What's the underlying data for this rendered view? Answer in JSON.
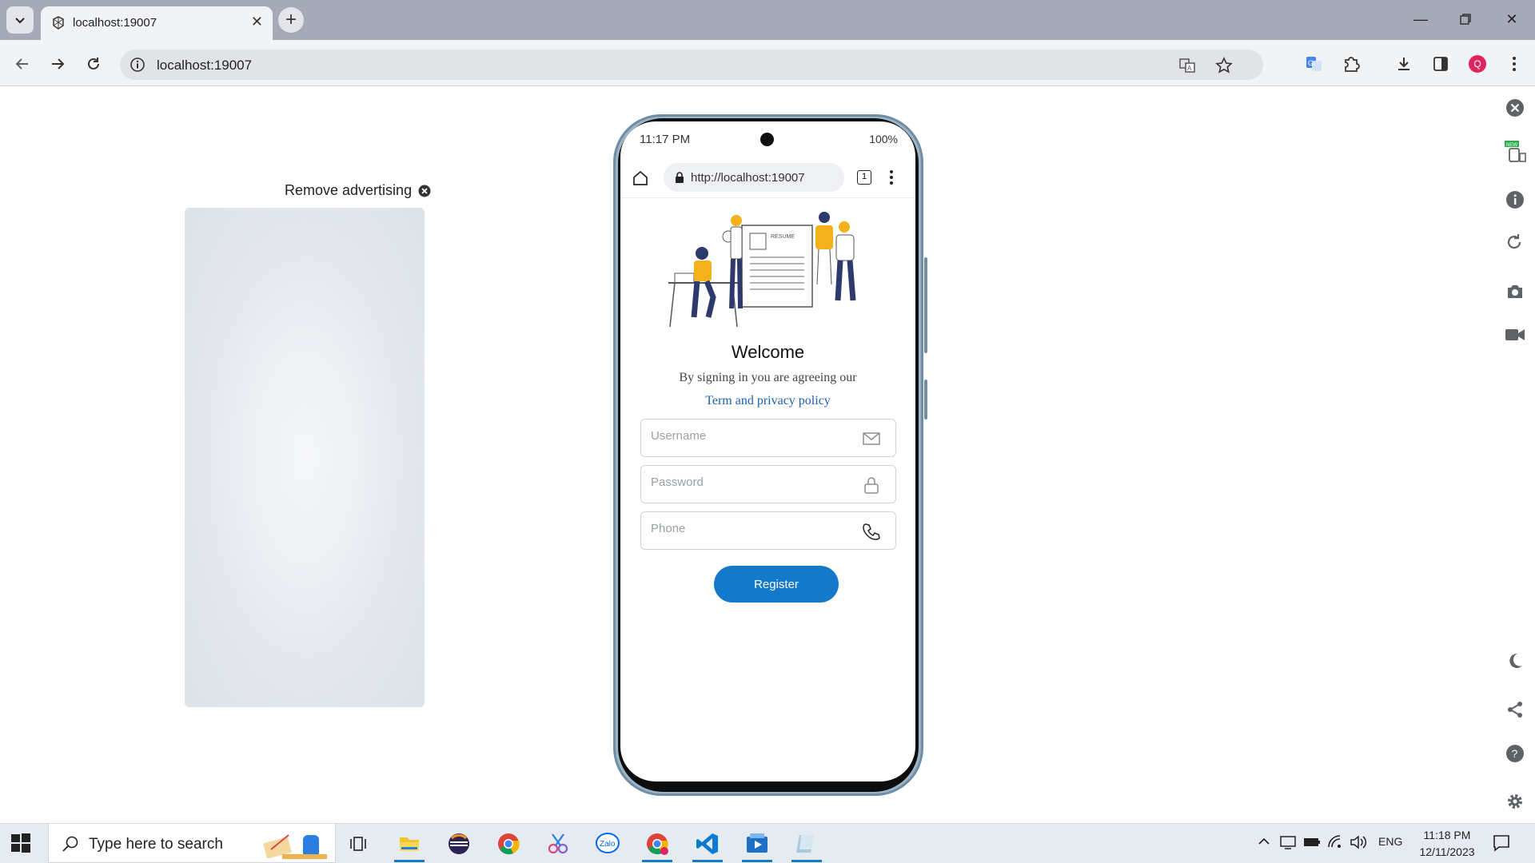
{
  "browser": {
    "tab_title": "localhost:19007",
    "url": "localhost:19007",
    "profile_initial": "Q"
  },
  "page": {
    "remove_ad_label": "Remove advertising"
  },
  "phone": {
    "status_time": "11:17 PM",
    "status_battery": "100%",
    "browser_url": "http://localhost:19007",
    "tab_count": "1",
    "welcome": "Welcome",
    "agree_text": "By signing in you are agreeing our",
    "terms_link": "Term and privacy policy",
    "username_placeholder": "Username",
    "password_placeholder": "Password",
    "phone_placeholder": "Phone",
    "register_label": "Register",
    "illustration_label": "RESUME"
  },
  "right_tools": {
    "new_badge": "NEW"
  },
  "taskbar": {
    "search_placeholder": "Type here to search",
    "zalo_label": "Zalo",
    "language": "ENG",
    "time": "11:18 PM",
    "date": "12/11/2023"
  },
  "colors": {
    "accent": "#1379c8",
    "link": "#1a5fb4",
    "tabstrip": "#a5a9b8"
  }
}
